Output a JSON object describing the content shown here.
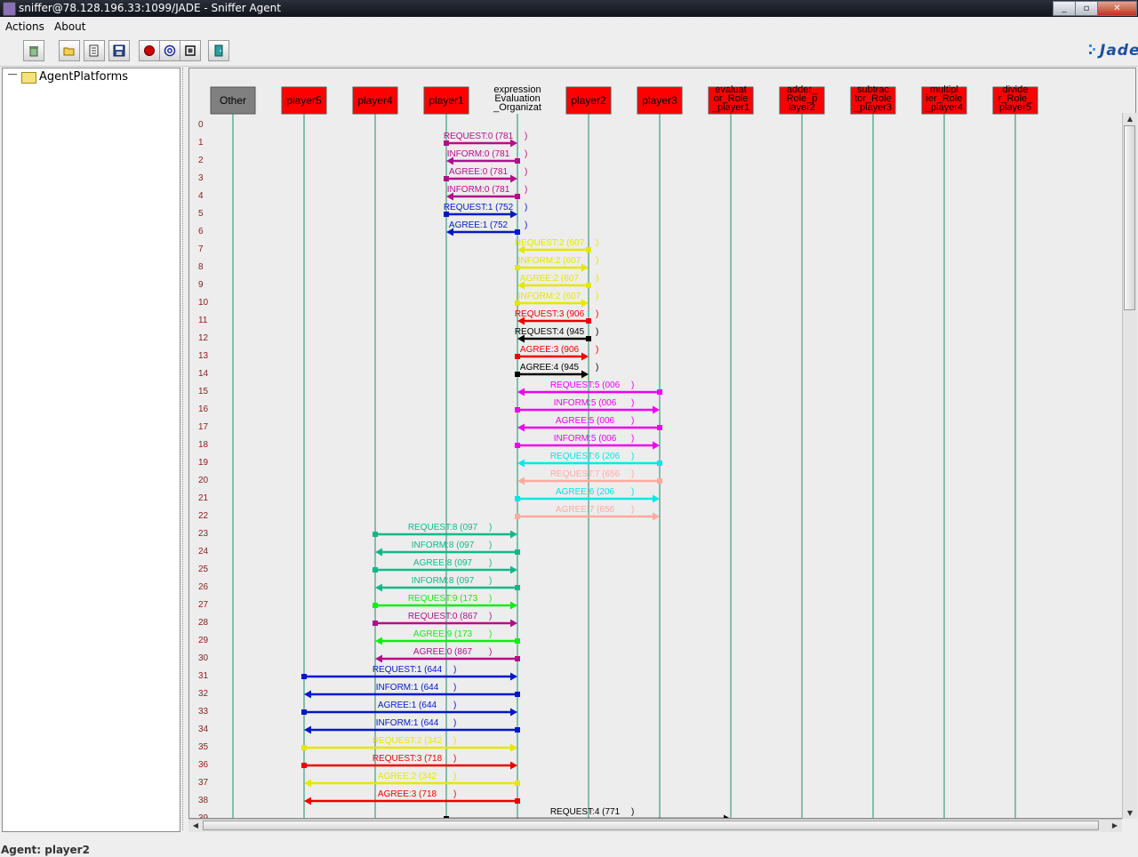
{
  "window": {
    "title": "sniffer@78.128.196.33:1099/JADE - Sniffer Agent",
    "controls": [
      "_",
      "▫",
      "✕"
    ]
  },
  "menu": [
    "Actions",
    "About"
  ],
  "toolbar": [
    {
      "name": "clear-canvas-button",
      "icon": "trash-icon"
    },
    {
      "name": "open-snapshot-button",
      "icon": "open-folder-icon"
    },
    {
      "name": "display-log-button",
      "icon": "log-file-icon"
    },
    {
      "name": "save-snapshot-button",
      "icon": "floppy-disk-icon"
    },
    {
      "name": "do-sniff-button",
      "icon": "record-dot-icon"
    },
    {
      "name": "show-only-button",
      "icon": "at-sign-icon"
    },
    {
      "name": "do-not-sniff-button",
      "icon": "square-icon"
    },
    {
      "name": "exit-button",
      "icon": "door-exit-icon"
    }
  ],
  "logo": "Jade",
  "tree": {
    "root": "AgentPlatforms"
  },
  "agents": [
    {
      "id": "Other",
      "lines": [
        "Other"
      ],
      "fill": "#808080",
      "text_color": "#000000"
    },
    {
      "id": "player5",
      "lines": [
        "player5"
      ],
      "fill": "#ff0000",
      "text_color": "#000000"
    },
    {
      "id": "player4",
      "lines": [
        "player4"
      ],
      "fill": "#ff0000",
      "text_color": "#000000"
    },
    {
      "id": "player1",
      "lines": [
        "player1"
      ],
      "fill": "#ff0000",
      "text_color": "#000000"
    },
    {
      "id": "expressionEvaluation",
      "lines": [
        "expression",
        "Evaluation",
        "_Organizat"
      ],
      "fill": "#ededed",
      "text_color": "#000000"
    },
    {
      "id": "player2",
      "lines": [
        "player2"
      ],
      "fill": "#ff0000",
      "text_color": "#000000"
    },
    {
      "id": "player3",
      "lines": [
        "player3"
      ],
      "fill": "#ff0000",
      "text_color": "#000000"
    },
    {
      "id": "evaluator",
      "lines": [
        "evaluat",
        "or_Role",
        "_player1"
      ],
      "fill": "#ff0000",
      "text_color": "#000000"
    },
    {
      "id": "adder",
      "lines": [
        "adder_",
        "Role_p",
        "layer2"
      ],
      "fill": "#ff0000",
      "text_color": "#000000"
    },
    {
      "id": "subtractor",
      "lines": [
        "subtrac",
        "tor_Role",
        "_player3"
      ],
      "fill": "#ff0000",
      "text_color": "#000000"
    },
    {
      "id": "multiplier",
      "lines": [
        "multipl",
        "ier_Role",
        "_player4"
      ],
      "fill": "#ff0000",
      "text_color": "#000000"
    },
    {
      "id": "divider",
      "lines": [
        "divide",
        "r_Role_",
        "player5"
      ],
      "fill": "#ff0000",
      "text_color": "#000000"
    }
  ],
  "row_numbers": [
    "0",
    "1",
    "2",
    "3",
    "4",
    "5",
    "6",
    "7",
    "8",
    "9",
    "10",
    "11",
    "12",
    "13",
    "14",
    "15",
    "16",
    "17",
    "18",
    "19",
    "20",
    "21",
    "22",
    "23",
    "24",
    "25",
    "26",
    "27",
    "28",
    "29",
    "30",
    "31",
    "32",
    "33",
    "34",
    "35",
    "36",
    "37",
    "38",
    "39"
  ],
  "messages": [
    {
      "row": 1,
      "from": 3,
      "to": 4,
      "label": "REQUEST:0 (781",
      "tail": ")",
      "color": "#b0108a"
    },
    {
      "row": 2,
      "from": 4,
      "to": 3,
      "label": "INFORM:0 (781",
      "tail": ")",
      "color": "#b0108a"
    },
    {
      "row": 3,
      "from": 3,
      "to": 4,
      "label": "AGREE:0 (781",
      "tail": ")",
      "color": "#b0108a"
    },
    {
      "row": 4,
      "from": 4,
      "to": 3,
      "label": "INFORM:0 (781",
      "tail": ")",
      "color": "#b0108a"
    },
    {
      "row": 5,
      "from": 3,
      "to": 4,
      "label": "REQUEST:1 (752",
      "tail": ")",
      "color": "#0018c8"
    },
    {
      "row": 6,
      "from": 4,
      "to": 3,
      "label": "AGREE:1 (752",
      "tail": ")",
      "color": "#0018c8"
    },
    {
      "row": 7,
      "from": 5,
      "to": 4,
      "label": "REQUEST:2 (607",
      "tail": ")",
      "color": "#e6e600"
    },
    {
      "row": 8,
      "from": 4,
      "to": 5,
      "label": "INFORM:2 (607",
      "tail": ")",
      "color": "#e6e600"
    },
    {
      "row": 9,
      "from": 5,
      "to": 4,
      "label": "AGREE:2 (607",
      "tail": ")",
      "color": "#e6e600"
    },
    {
      "row": 10,
      "from": 4,
      "to": 5,
      "label": "INFORM:2 (607",
      "tail": ")",
      "color": "#e6e600"
    },
    {
      "row": 11,
      "from": 5,
      "to": 4,
      "label": "REQUEST:3 (906",
      "tail": ")",
      "color": "#ee0000"
    },
    {
      "row": 12,
      "from": 5,
      "to": 4,
      "label": "REQUEST:4 (945",
      "tail": ")",
      "color": "#000000"
    },
    {
      "row": 13,
      "from": 4,
      "to": 5,
      "label": "AGREE:3 (906",
      "tail": ")",
      "color": "#ee0000"
    },
    {
      "row": 14,
      "from": 4,
      "to": 5,
      "label": "AGREE:4 (945",
      "tail": ")",
      "color": "#000000"
    },
    {
      "row": 15,
      "from": 6,
      "to": 4,
      "label": "REQUEST:5 (006",
      "tail": ")",
      "color": "#ee00ee"
    },
    {
      "row": 16,
      "from": 4,
      "to": 6,
      "label": "INFORM:5 (006",
      "tail": ")",
      "color": "#ee00ee"
    },
    {
      "row": 17,
      "from": 6,
      "to": 4,
      "label": "AGREE:5 (006",
      "tail": ")",
      "color": "#ee00ee"
    },
    {
      "row": 18,
      "from": 4,
      "to": 6,
      "label": "INFORM:5 (006",
      "tail": ")",
      "color": "#ee00ee"
    },
    {
      "row": 19,
      "from": 6,
      "to": 4,
      "label": "REQUEST:6 (206",
      "tail": ")",
      "color": "#00e8e8"
    },
    {
      "row": 20,
      "from": 6,
      "to": 4,
      "label": "REQUEST:7 (656",
      "tail": ")",
      "color": "#ffaaa0"
    },
    {
      "row": 21,
      "from": 4,
      "to": 6,
      "label": "AGREE:6 (206",
      "tail": ")",
      "color": "#00e8e8"
    },
    {
      "row": 22,
      "from": 4,
      "to": 6,
      "label": "AGREE:7 (656",
      "tail": ")",
      "color": "#ffaaa0"
    },
    {
      "row": 23,
      "from": 2,
      "to": 4,
      "label": "REQUEST:8 (097",
      "tail": ")",
      "color": "#10b888"
    },
    {
      "row": 24,
      "from": 4,
      "to": 2,
      "label": "INFORM:8 (097",
      "tail": ")",
      "color": "#10b888"
    },
    {
      "row": 25,
      "from": 2,
      "to": 4,
      "label": "AGREE:8 (097",
      "tail": ")",
      "color": "#10b888"
    },
    {
      "row": 26,
      "from": 4,
      "to": 2,
      "label": "INFORM:8 (097",
      "tail": ")",
      "color": "#10b888"
    },
    {
      "row": 27,
      "from": 2,
      "to": 4,
      "label": "REQUEST:9 (173",
      "tail": ")",
      "color": "#10ee10"
    },
    {
      "row": 28,
      "from": 2,
      "to": 4,
      "label": "REQUEST:0 (867",
      "tail": ")",
      "color": "#b0108a"
    },
    {
      "row": 29,
      "from": 4,
      "to": 2,
      "label": "AGREE:9 (173",
      "tail": ")",
      "color": "#10ee10"
    },
    {
      "row": 30,
      "from": 4,
      "to": 2,
      "label": "AGREE:0 (867",
      "tail": ")",
      "color": "#b0108a"
    },
    {
      "row": 31,
      "from": 1,
      "to": 4,
      "label": "REQUEST:1 (644",
      "tail": ")",
      "color": "#0018c8"
    },
    {
      "row": 32,
      "from": 4,
      "to": 1,
      "label": "INFORM:1 (644",
      "tail": ")",
      "color": "#0018c8"
    },
    {
      "row": 33,
      "from": 1,
      "to": 4,
      "label": "AGREE:1 (644",
      "tail": ")",
      "color": "#0018c8"
    },
    {
      "row": 34,
      "from": 4,
      "to": 1,
      "label": "INFORM:1 (644",
      "tail": ")",
      "color": "#0018c8"
    },
    {
      "row": 35,
      "from": 1,
      "to": 4,
      "label": "REQUEST:2 (342",
      "tail": ")",
      "color": "#e6e600"
    },
    {
      "row": 36,
      "from": 1,
      "to": 4,
      "label": "REQUEST:3 (718",
      "tail": ")",
      "color": "#ee0000"
    },
    {
      "row": 37,
      "from": 4,
      "to": 1,
      "label": "AGREE:2 (342",
      "tail": ")",
      "color": "#e6e600"
    },
    {
      "row": 38,
      "from": 4,
      "to": 1,
      "label": "AGREE:3 (718",
      "tail": ")",
      "color": "#ee0000"
    },
    {
      "row": 39,
      "from": 3,
      "to": 7,
      "label": "REQUEST:4 (771",
      "tail": ")",
      "color": "#000000"
    }
  ],
  "status": "Agent: player2"
}
